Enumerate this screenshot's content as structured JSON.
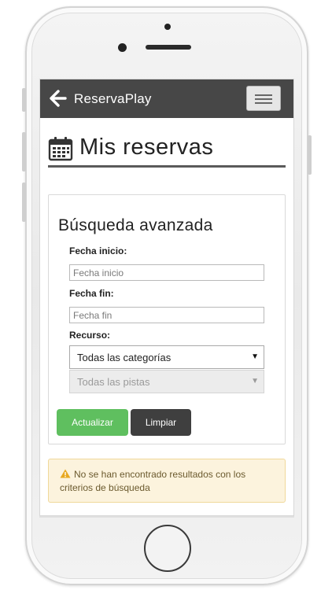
{
  "navbar": {
    "brand": "ReservaPlay",
    "back_icon": "arrow-left-icon",
    "menu_icon": "hamburger-menu-icon",
    "background": "#474747"
  },
  "header": {
    "title": "Mis reservas",
    "icon": "calendar-icon"
  },
  "search": {
    "title": "Búsqueda avanzada",
    "start_label": "Fecha inicio:",
    "start_placeholder": "Fecha inicio",
    "end_label": "Fecha fin:",
    "end_placeholder": "Fecha fin",
    "resource_label": "Recurso:",
    "category_selected": "Todas las categorías",
    "court_selected": "Todas las pistas",
    "update_label": "Actualizar",
    "clear_label": "Limpiar"
  },
  "alert": {
    "icon": "warning-icon",
    "message": "No se han encontrado resultados con los criterios de búsqueda"
  },
  "colors": {
    "accent_green": "#5fbf5f",
    "dark_button": "#3f3f3f",
    "alert_bg": "#fcf3dd"
  }
}
